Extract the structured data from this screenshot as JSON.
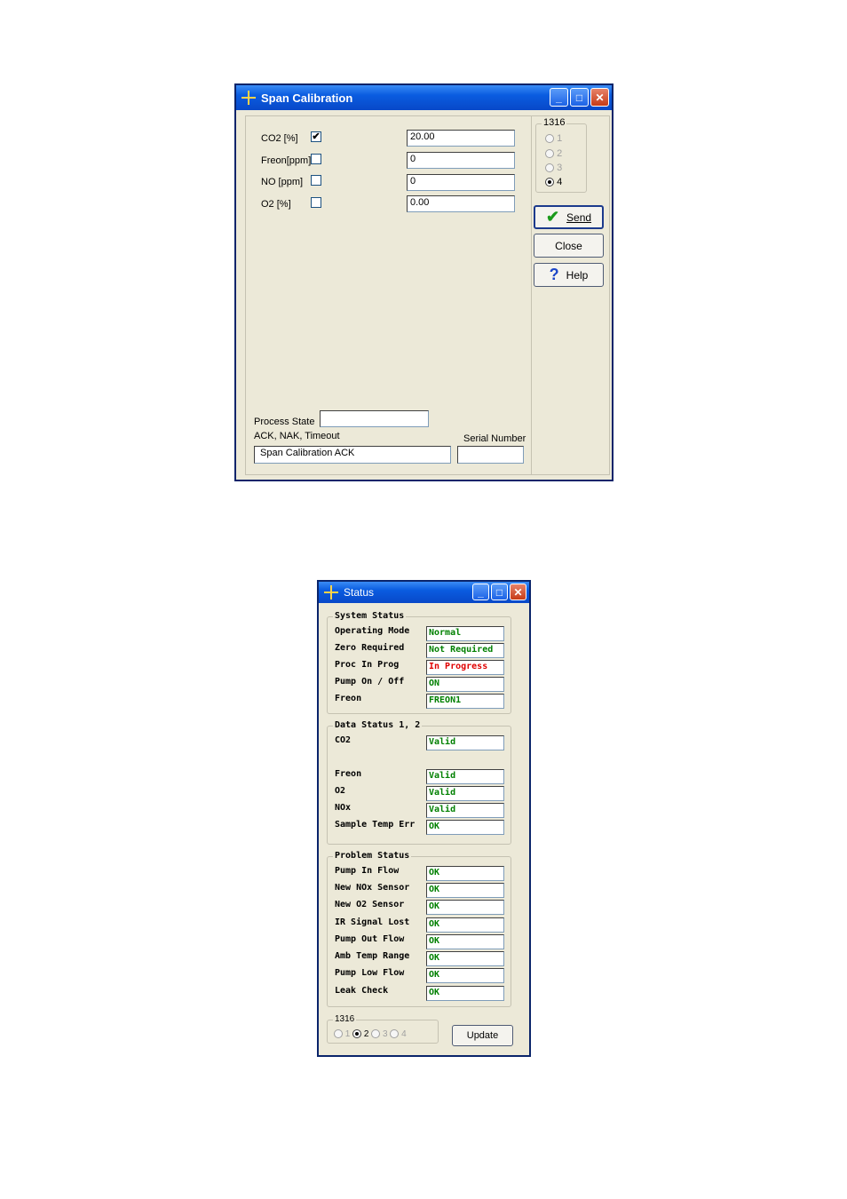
{
  "span": {
    "title": "Span Calibration",
    "rows": [
      {
        "label": "CO2 [%]",
        "checked": "✔",
        "value": "20.00"
      },
      {
        "label": "Freon[ppm]",
        "checked": "",
        "value": "0"
      },
      {
        "label": "NO [ppm]",
        "checked": "",
        "value": "0"
      },
      {
        "label": "O2 [%]",
        "checked": "",
        "value": "0.00"
      }
    ],
    "group_label": "1316",
    "radios": [
      "1",
      "2",
      "3",
      "4"
    ],
    "selected_radio": "4",
    "send_label": "Send",
    "close_label": "Close",
    "help_label": "Help",
    "process_state_label": "Process State",
    "process_state_value": "",
    "ack_label": "ACK, NAK, Timeout",
    "ack_value": "Span Calibration  ACK",
    "serial_label": "Serial Number",
    "serial_value": ""
  },
  "status": {
    "title": "Status",
    "system": {
      "label": "System Status",
      "rows": [
        {
          "label": "Operating Mode",
          "value": "Normal",
          "color": "#008000"
        },
        {
          "label": "Zero Required",
          "value": "Not Required",
          "color": "#008000"
        },
        {
          "label": "Proc In Prog",
          "value": "In Progress",
          "color": "#e00000"
        },
        {
          "label": "Pump On / Off",
          "value": "ON",
          "color": "#008000"
        },
        {
          "label": "Freon",
          "value": "FREON1",
          "color": "#008000"
        }
      ]
    },
    "data": {
      "label": "Data Status 1, 2",
      "rows": [
        {
          "label": "CO2",
          "value": "Valid",
          "color": "#008000"
        },
        {
          "label": "Freon",
          "value": "Valid",
          "color": "#008000"
        },
        {
          "label": "O2",
          "value": "Valid",
          "color": "#008000"
        },
        {
          "label": "NOx",
          "value": "Valid",
          "color": "#008000"
        },
        {
          "label": "Sample Temp Err",
          "value": "OK",
          "color": "#008000"
        }
      ]
    },
    "problem": {
      "label": "Problem Status",
      "rows": [
        {
          "label": "Pump In Flow",
          "value": "OK",
          "color": "#008000"
        },
        {
          "label": "New NOx Sensor",
          "value": "OK",
          "color": "#008000"
        },
        {
          "label": "New O2 Sensor",
          "value": "OK",
          "color": "#008000"
        },
        {
          "label": "IR Signal Lost",
          "value": "OK",
          "color": "#008000"
        },
        {
          "label": "Pump Out Flow",
          "value": "OK",
          "color": "#008000"
        },
        {
          "label": "Amb Temp Range",
          "value": "OK",
          "color": "#008000"
        },
        {
          "label": "Pump Low Flow",
          "value": "OK",
          "color": "#008000"
        },
        {
          "label": "Leak Check",
          "value": "OK",
          "color": "#008000"
        }
      ]
    },
    "group_label": "1316",
    "radios": [
      "1",
      "2",
      "3",
      "4"
    ],
    "selected_radio": "2",
    "update_label": "Update"
  }
}
